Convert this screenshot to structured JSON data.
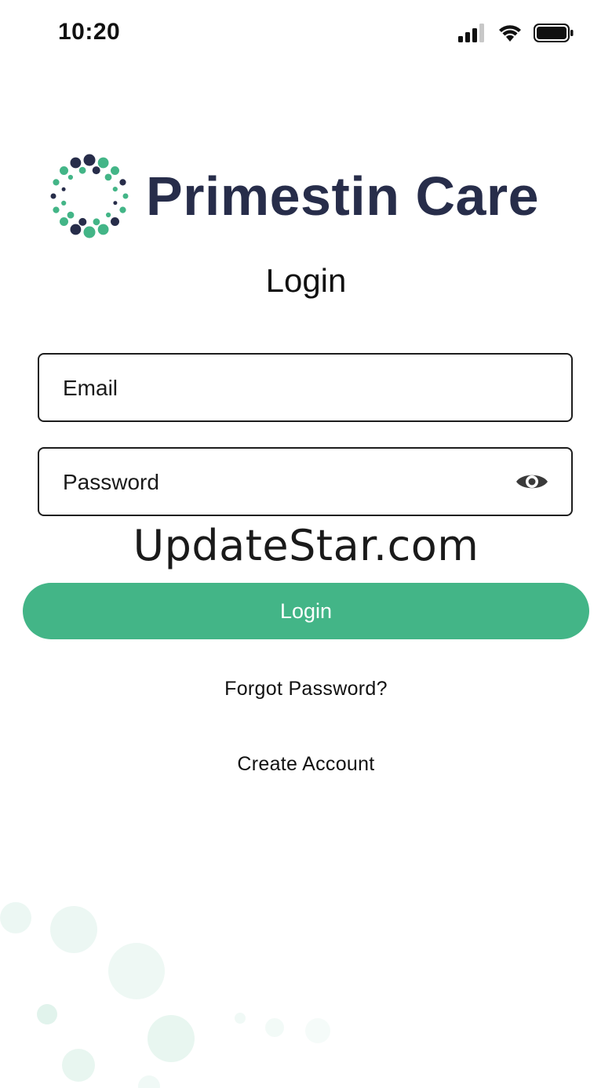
{
  "status_bar": {
    "time": "10:20",
    "icons": [
      "cellular-signal-icon",
      "wifi-icon",
      "battery-icon"
    ]
  },
  "brand": {
    "name": "Primestin Care",
    "text_color": "#272d4a",
    "accent_color": "#43b587"
  },
  "login_form": {
    "title": "Login",
    "email_placeholder": "Email",
    "password_placeholder": "Password",
    "password_toggle_icon": "eye-icon",
    "submit_label": "Login",
    "forgot_password_label": "Forgot Password?",
    "create_account_label": "Create Account"
  },
  "watermark": {
    "text": "UpdateStar.com"
  }
}
